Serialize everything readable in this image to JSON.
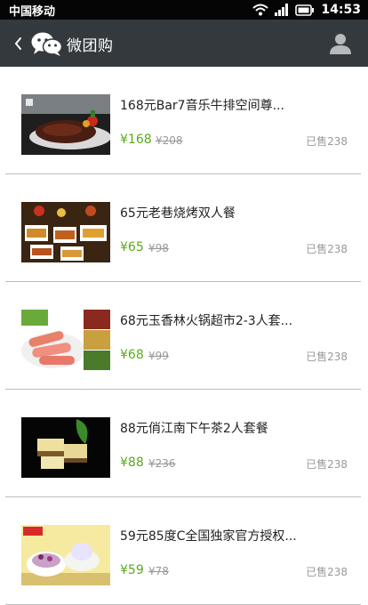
{
  "status_bar": {
    "carrier": "中国移动",
    "time": "14:53",
    "icons": [
      "wifi-icon",
      "signal-icon",
      "battery-icon"
    ]
  },
  "header": {
    "title": "微团购",
    "back_icon": "chevron-left-icon",
    "logo_icon": "wechat-logo-icon",
    "profile_icon": "user-icon"
  },
  "colors": {
    "header_bg": "#34393d",
    "status_bg": "#050505",
    "price_green": "#5aaa1a",
    "muted": "#999999"
  },
  "deals": [
    {
      "title": "168元Bar7音乐牛排空间尊...",
      "price": "¥168",
      "original_price": "¥208",
      "sold": "已售238",
      "thumb": "steak-image"
    },
    {
      "title": "65元老巷烧烤双人餐",
      "price": "¥65",
      "original_price": "¥98",
      "sold": "已售238",
      "thumb": "bbq-image"
    },
    {
      "title": "68元玉香林火锅超市2-3人套...",
      "price": "¥68",
      "original_price": "¥99",
      "sold": "已售238",
      "thumb": "hotpot-image"
    },
    {
      "title": "88元俏江南下午茶2人套餐",
      "price": "¥88",
      "original_price": "¥236",
      "sold": "已售238",
      "thumb": "afternoon-tea-image"
    },
    {
      "title": "59元85度C全国独家官方授权...",
      "price": "¥59",
      "original_price": "¥78",
      "sold": "已售238",
      "thumb": "cake-image"
    }
  ]
}
